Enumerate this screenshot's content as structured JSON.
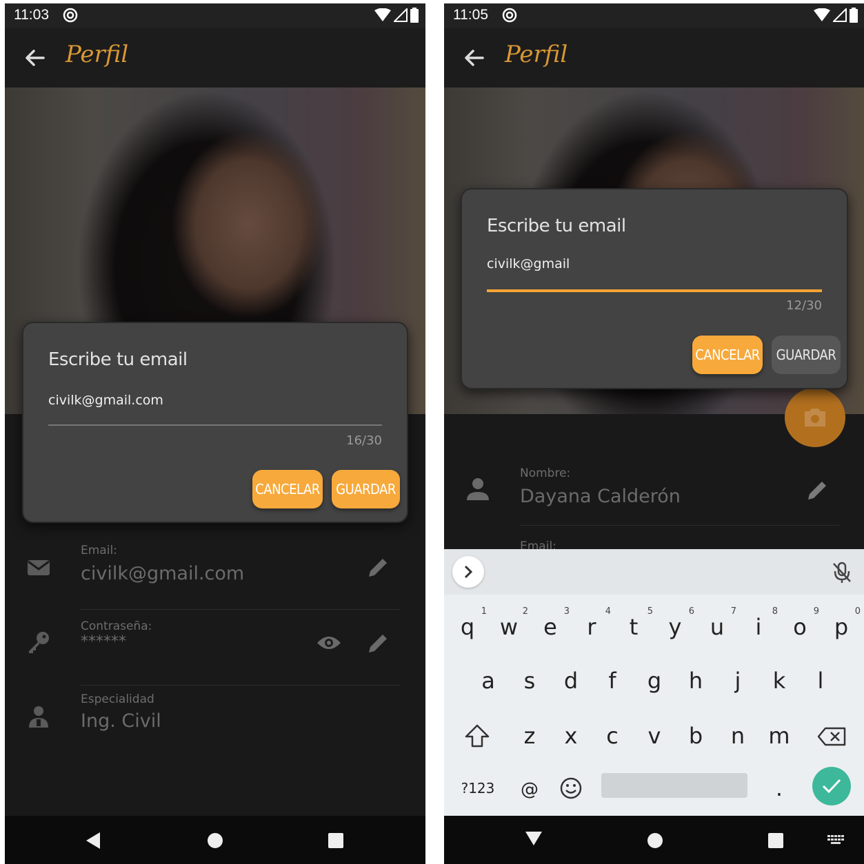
{
  "colors": {
    "accent": "#f7a93b",
    "title": "#d99834",
    "background": "#191919",
    "dialog": "#434343",
    "enter_key": "#3db89b"
  },
  "left": {
    "status": {
      "time": "11:03"
    },
    "appbar": {
      "title": "Perfil"
    },
    "dialog": {
      "title": "Escribe tu email",
      "value": "civilk@gmail.com",
      "counter": "16/30",
      "cancel_label": "CANCELAR",
      "save_label": "GUARDAR"
    },
    "fields": {
      "email": {
        "label": "Email:",
        "value": "civilk@gmail.com"
      },
      "password": {
        "label": "Contraseña:",
        "value": "******"
      },
      "specialty": {
        "label": "Especialidad",
        "value": "Ing. Civil"
      }
    }
  },
  "right": {
    "status": {
      "time": "11:05"
    },
    "appbar": {
      "title": "Perfil"
    },
    "dialog": {
      "title": "Escribe tu email",
      "value": "civilk@gmail",
      "counter": "12/30",
      "cancel_label": "CANCELAR",
      "save_label": "GUARDAR"
    },
    "fields": {
      "name": {
        "label": "Nombre:",
        "value": "Dayana Calderón"
      },
      "email_label_partial": "Email:"
    },
    "keyboard": {
      "row1": [
        "q",
        "w",
        "e",
        "r",
        "t",
        "y",
        "u",
        "i",
        "o",
        "p"
      ],
      "row1_hints": [
        "1",
        "2",
        "3",
        "4",
        "5",
        "6",
        "7",
        "8",
        "9",
        "0"
      ],
      "row2": [
        "a",
        "s",
        "d",
        "f",
        "g",
        "h",
        "j",
        "k",
        "l"
      ],
      "row3": [
        "z",
        "x",
        "c",
        "v",
        "b",
        "n",
        "m"
      ],
      "symbols_key": "?123",
      "at_key": "@",
      "period_key": "."
    }
  }
}
